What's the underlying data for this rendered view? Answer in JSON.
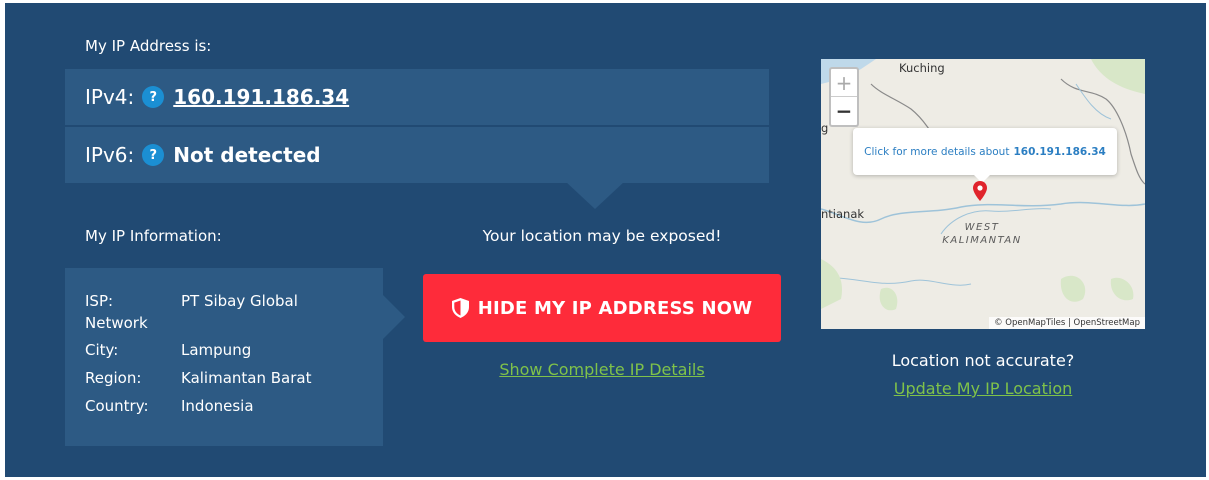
{
  "ip_section": {
    "heading": "My IP Address is:",
    "ipv4": {
      "label": "IPv4:",
      "help_icon": "?",
      "value": "160.191.186.34"
    },
    "ipv6": {
      "label": "IPv6:",
      "help_icon": "?",
      "value": "Not detected"
    }
  },
  "info_section": {
    "heading": "My IP Information:",
    "rows": [
      {
        "key": "ISP:",
        "value": "PT Sibay Global",
        "value_cont": "Network"
      },
      {
        "key": "City:",
        "value": "Lampung"
      },
      {
        "key": "Region:",
        "value": "Kalimantan Barat"
      },
      {
        "key": "Country:",
        "value": "Indonesia"
      }
    ]
  },
  "cta": {
    "warning": "Your location may be exposed!",
    "button_label": "HIDE MY IP ADDRESS NOW",
    "button_icon": "shield-icon",
    "details_link": "Show Complete IP Details"
  },
  "map": {
    "zoom_in": "+",
    "zoom_out": "−",
    "popup_text": "Click for more details about",
    "popup_ip": "160.191.186.34",
    "city_label": "Kuching",
    "city_label_left": "ntianak",
    "small_label": "g",
    "region_label_1": "WEST",
    "region_label_2": "KALIMANTAN",
    "attribution": "© OpenMapTiles | OpenStreetMap"
  },
  "location_section": {
    "question": "Location not accurate?",
    "update_link": "Update My IP Location"
  },
  "colors": {
    "panel_bg": "#214a73",
    "row_bg": "#2d5a84",
    "button_red": "#fe2b3a",
    "link_green": "#7fc24a",
    "help_blue": "#1b8fd3"
  }
}
